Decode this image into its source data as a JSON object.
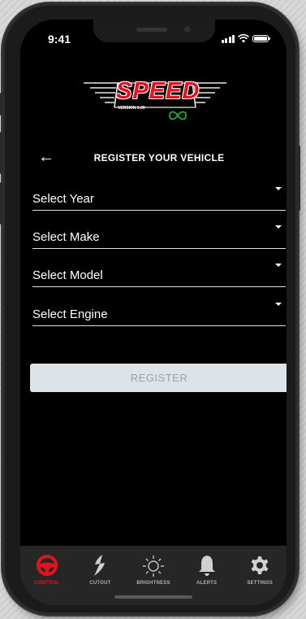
{
  "status_bar": {
    "time": "9:41"
  },
  "logo": {
    "text": "SPEED",
    "version": "VERSION 1.00"
  },
  "header": {
    "back_icon": "arrow-left-icon",
    "title": "REGISTER YOUR VEHICLE"
  },
  "selects": [
    {
      "label": "Select Year"
    },
    {
      "label": "Select Make"
    },
    {
      "label": "Select Model"
    },
    {
      "label": "Select Engine"
    }
  ],
  "register_button": {
    "label": "REGISTER"
  },
  "tabs": [
    {
      "label": "CONTROL",
      "icon": "steering-wheel-icon",
      "active": true
    },
    {
      "label": "CUTOUT",
      "icon": "lightning-icon",
      "active": false
    },
    {
      "label": "BRIGHTNESS",
      "icon": "sun-icon",
      "active": false
    },
    {
      "label": "ALERTS",
      "icon": "bell-icon",
      "active": false
    },
    {
      "label": "SETTINGS",
      "icon": "gear-icon",
      "active": false
    }
  ],
  "colors": {
    "accent": "#e8101c",
    "background": "#000000",
    "tab_bar": "#262626",
    "register_bg": "#dde3e6",
    "logo_infinity": "#1fb03a"
  }
}
